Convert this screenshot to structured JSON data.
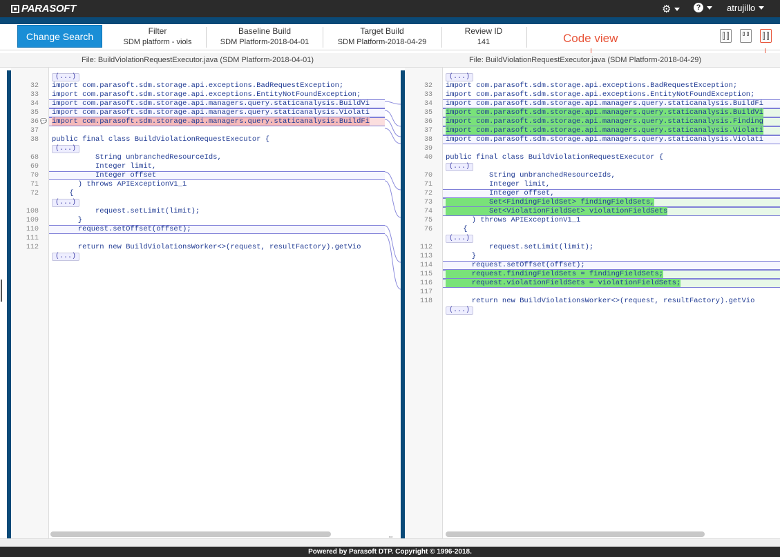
{
  "app": {
    "logo": "PARASOFT",
    "user": "atrujillo"
  },
  "header": {
    "change_search": "Change Search",
    "filter_label": "Filter",
    "filter_value": "SDM platform - viols",
    "baseline_label": "Baseline Build",
    "baseline_value": "SDM Platform-2018-04-01",
    "target_label": "Target Build",
    "target_value": "SDM Platform-2018-04-29",
    "review_label": "Review ID",
    "review_value": "141",
    "code_view_note": "Code view"
  },
  "left": {
    "file": "File: BuildViolationRequestExecutor.java (SDM Platform-2018-04-01)",
    "lines": [
      {
        "n": "",
        "t": "(...)",
        "e": true
      },
      {
        "n": "32",
        "t": "import com.parasoft.sdm.storage.api.exceptions.BadRequestException;"
      },
      {
        "n": "33",
        "t": "import com.parasoft.sdm.storage.api.exceptions.EntityNotFoundException;"
      },
      {
        "n": "34",
        "t": "import com.parasoft.sdm.storage.api.managers.query.staticanalysis.BuildVi",
        "box": true
      },
      {
        "n": "35",
        "t": "import com.parasoft.sdm.storage.api.managers.query.staticanalysis.Violati",
        "box": true
      },
      {
        "n": "36",
        "t": "import com.parasoft.sdm.storage.api.managers.query.staticanalysis.BuildFi",
        "red": true,
        "comment": true
      },
      {
        "n": "37",
        "t": ""
      },
      {
        "n": "38",
        "t": "public final class BuildViolationRequestExecutor {"
      },
      {
        "n": "",
        "t": "(...)",
        "e": true
      },
      {
        "n": "68",
        "t": "          String unbranchedResourceIds,"
      },
      {
        "n": "69",
        "t": "          Integer limit,"
      },
      {
        "n": "70",
        "t": "          Integer offset",
        "box": true
      },
      {
        "n": "71",
        "t": "      ) throws APIExceptionV1_1"
      },
      {
        "n": "72",
        "t": "    {"
      },
      {
        "n": "",
        "t": "(...)",
        "e": true
      },
      {
        "n": "108",
        "t": "          request.setLimit(limit);"
      },
      {
        "n": "109",
        "t": "      }"
      },
      {
        "n": "110",
        "t": "      request.setOffset(offset);",
        "box": true
      },
      {
        "n": "111",
        "t": ""
      },
      {
        "n": "112",
        "t": "      return new BuildViolationsWorker<>(request, resultFactory).getVio"
      },
      {
        "n": "",
        "t": "(...)",
        "e": true
      }
    ]
  },
  "right": {
    "file": "File: BuildViolationRequestExecutor.java (SDM Platform-2018-04-29)",
    "lines": [
      {
        "n": "",
        "t": "(...)",
        "e": true
      },
      {
        "n": "32",
        "t": "import com.parasoft.sdm.storage.api.exceptions.BadRequestException;"
      },
      {
        "n": "33",
        "t": "import com.parasoft.sdm.storage.api.exceptions.EntityNotFoundException;"
      },
      {
        "n": "34",
        "t": "import com.parasoft.sdm.storage.api.managers.query.staticanalysis.BuildFi",
        "box": true
      },
      {
        "n": "35",
        "t": "import com.parasoft.sdm.storage.api.managers.query.staticanalysis.BuildVi",
        "green": true
      },
      {
        "n": "36",
        "t": "import com.parasoft.sdm.storage.api.managers.query.staticanalysis.Finding",
        "green": true
      },
      {
        "n": "37",
        "t": "import com.parasoft.sdm.storage.api.managers.query.staticanalysis.Violati",
        "green": true
      },
      {
        "n": "38",
        "t": "import com.parasoft.sdm.storage.api.managers.query.staticanalysis.Violati",
        "box": true
      },
      {
        "n": "39",
        "t": ""
      },
      {
        "n": "40",
        "t": "public final class BuildViolationRequestExecutor {"
      },
      {
        "n": "",
        "t": "(...)",
        "e": true
      },
      {
        "n": "70",
        "t": "          String unbranchedResourceIds,"
      },
      {
        "n": "71",
        "t": "          Integer limit,"
      },
      {
        "n": "72",
        "t": "          Integer offset,",
        "box": true
      },
      {
        "n": "73",
        "t": "          Set<FindingFieldSet> findingFieldSets,",
        "green": true
      },
      {
        "n": "74",
        "t": "          Set<ViolationFieldSet> violationFieldSets",
        "green": true
      },
      {
        "n": "75",
        "t": "      ) throws APIExceptionV1_1"
      },
      {
        "n": "76",
        "t": "    {"
      },
      {
        "n": "",
        "t": "(...)",
        "e": true
      },
      {
        "n": "112",
        "t": "          request.setLimit(limit);"
      },
      {
        "n": "113",
        "t": "      }"
      },
      {
        "n": "114",
        "t": "      request.setOffset(offset);",
        "box": true
      },
      {
        "n": "115",
        "t": "      request.findingFieldSets = findingFieldSets;",
        "green": true
      },
      {
        "n": "116",
        "t": "      request.violationFieldSets = violationFieldSets;",
        "green": true
      },
      {
        "n": "117",
        "t": ""
      },
      {
        "n": "118",
        "t": "      return new BuildViolationsWorker<>(request, resultFactory).getVio"
      },
      {
        "n": "",
        "t": "(...)",
        "e": true
      }
    ]
  },
  "footer": "Powered by Parasoft DTP. Copyright © 1996-2018."
}
